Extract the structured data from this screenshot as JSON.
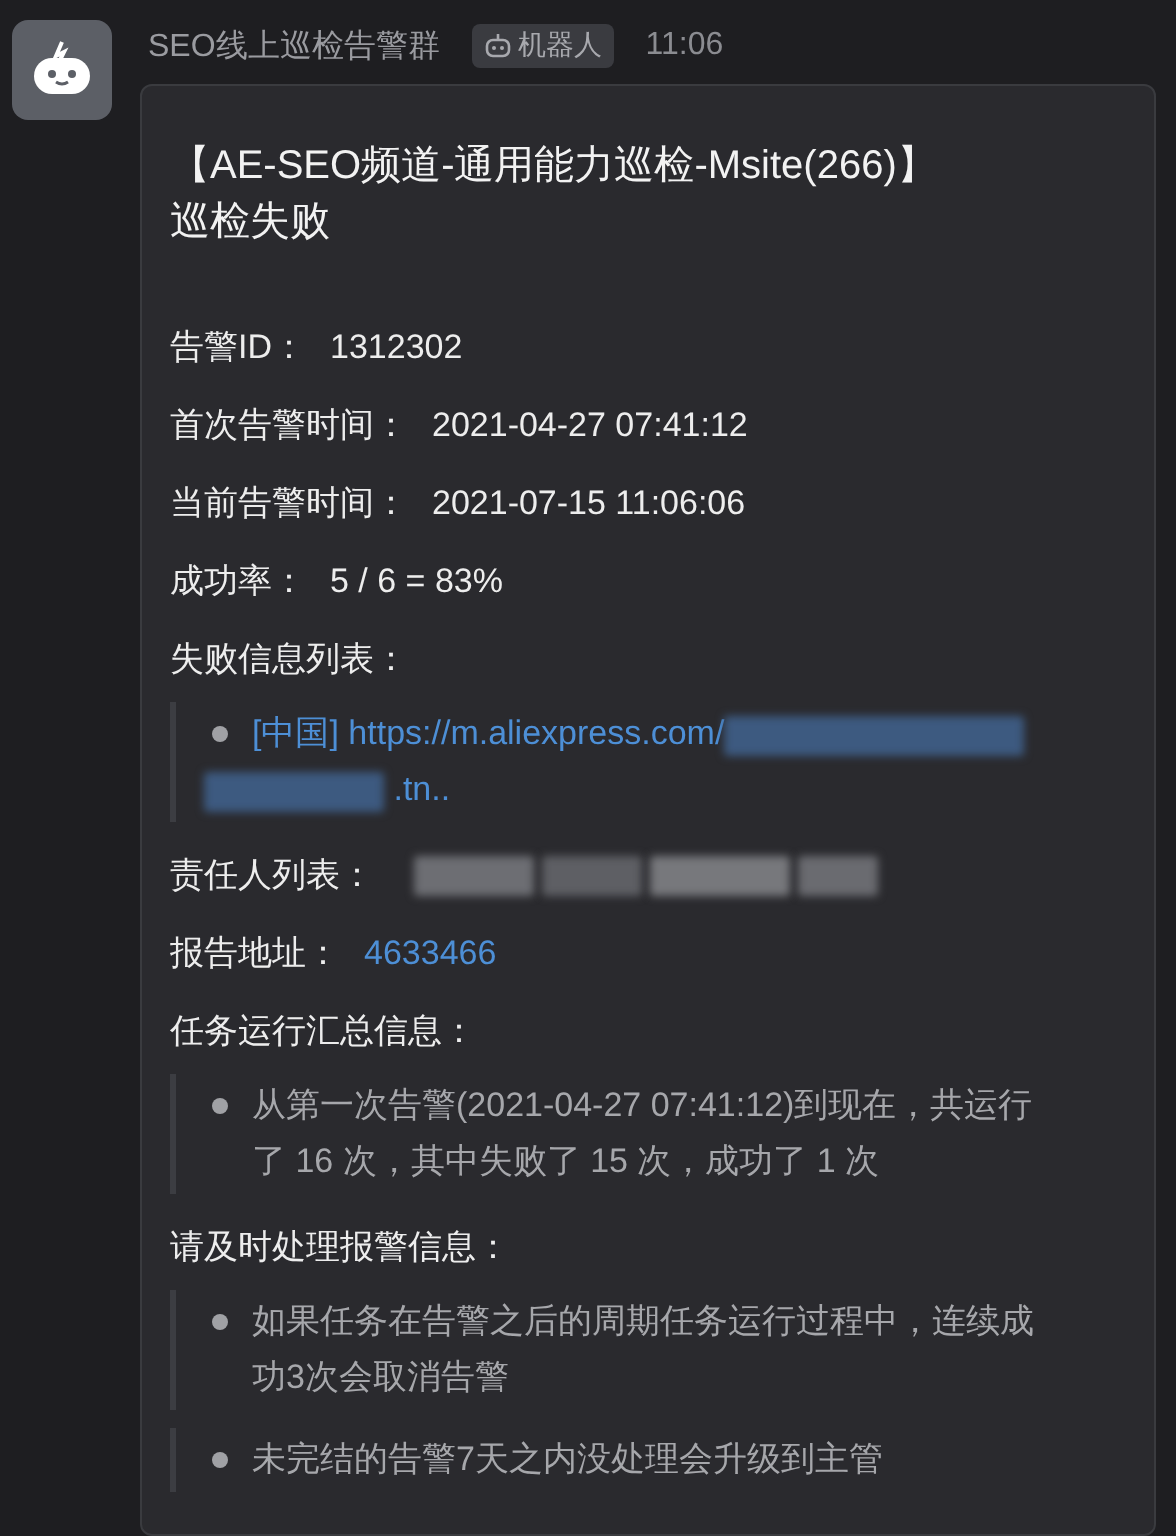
{
  "header": {
    "sender": "SEO线上巡检告警群",
    "badge": "机器人",
    "time": "11:06"
  },
  "card": {
    "title_lines": [
      "【AE-SEO频道-通用能力巡检-Msite(266)】",
      "巡检失败"
    ],
    "sections": [
      {
        "kind": "field",
        "label": "告警ID：",
        "value": "1312302"
      },
      {
        "kind": "field",
        "label": "首次告警时间：",
        "value": "2021-04-27 07:41:12"
      },
      {
        "kind": "field",
        "label": "当前告警时间：",
        "value": "2021-07-15 11:06:06"
      },
      {
        "kind": "field",
        "label": "成功率：",
        "value": "5 / 6 = 83%"
      },
      {
        "kind": "heading",
        "label": "失败信息列表："
      },
      {
        "kind": "quote",
        "items": [
          {
            "kind": "link",
            "text": "[中国] https://m.aliexpress.com/",
            "redacted": true,
            "tail": ".tn.."
          }
        ]
      },
      {
        "kind": "redacted_field",
        "label": "责任人列表："
      },
      {
        "kind": "link_field",
        "label": "报告地址：",
        "value": "4633466"
      },
      {
        "kind": "heading",
        "label": "任务运行汇总信息："
      },
      {
        "kind": "quote",
        "items": [
          {
            "kind": "text",
            "text": "从第一次告警(2021-04-27 07:41:12)到现在，共运行了 16 次，其中失败了 15 次，成功了 1 次"
          }
        ]
      },
      {
        "kind": "heading",
        "label": "请及时处理报警信息："
      },
      {
        "kind": "quote",
        "items": [
          {
            "kind": "text",
            "text": "如果任务在告警之后的周期任务运行过程中，连续成功3次会取消告警"
          }
        ]
      },
      {
        "kind": "quote",
        "items": [
          {
            "kind": "text",
            "text": "未完结的告警7天之内没处理会升级到主管"
          }
        ]
      }
    ]
  }
}
